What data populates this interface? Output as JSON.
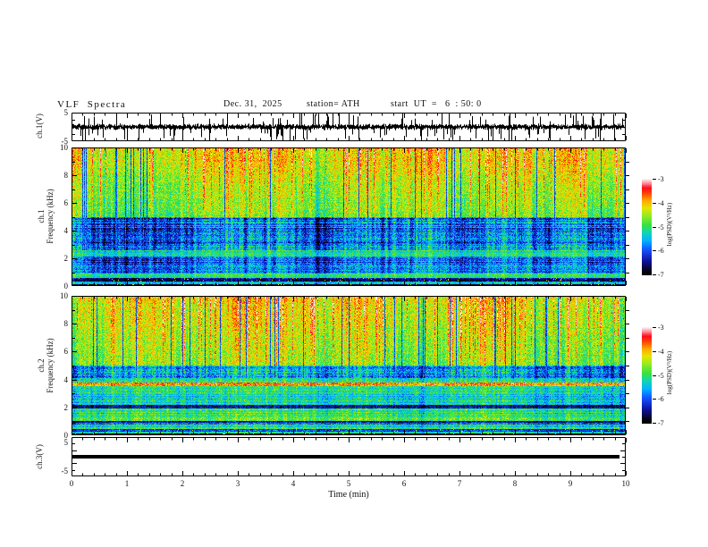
{
  "header": {
    "title": "VLF  Spectra",
    "date": "Dec. 31,  2025",
    "station": "station= ATH",
    "start_ut": "start  UT  =   6  : 50: 0"
  },
  "xaxis": {
    "label": "Time  (min)",
    "ticks": [
      0,
      1,
      2,
      3,
      4,
      5,
      6,
      7,
      8,
      9,
      10
    ],
    "range_min": [
      0,
      10
    ]
  },
  "colorbars": [
    {
      "label": "log(PSD)(V²/Hz)",
      "ticks": [
        -3,
        -4,
        -5,
        -6,
        -7
      ],
      "range": [
        -7,
        -3
      ]
    },
    {
      "label": "log(PSD)(V²/Hz)",
      "ticks": [
        -3,
        -4,
        -5,
        -6,
        -7
      ],
      "range": [
        -7,
        -3
      ]
    }
  ],
  "colormap_stops": [
    [
      0.0,
      0,
      0,
      0
    ],
    [
      0.05,
      5,
      5,
      30
    ],
    [
      0.14,
      15,
      15,
      150
    ],
    [
      0.26,
      20,
      80,
      255
    ],
    [
      0.36,
      0,
      180,
      255
    ],
    [
      0.45,
      20,
      215,
      170
    ],
    [
      0.52,
      55,
      225,
      65
    ],
    [
      0.62,
      150,
      235,
      35
    ],
    [
      0.7,
      232,
      228,
      0
    ],
    [
      0.78,
      255,
      165,
      0
    ],
    [
      0.85,
      255,
      70,
      0
    ],
    [
      0.91,
      255,
      10,
      30
    ],
    [
      0.96,
      255,
      150,
      160
    ],
    [
      1.0,
      255,
      235,
      240
    ]
  ],
  "chart_data": [
    {
      "id": "ch1_wave",
      "type": "line",
      "ylabel": "ch.1(V)",
      "ylim": [
        -5,
        5
      ],
      "yticks": [
        5,
        -5
      ],
      "signal": {
        "kind": "broadband-noise",
        "sigma_V": 0.7,
        "spike_rate": 0.13,
        "spike_amp_V": [
          2,
          5.5
        ]
      }
    },
    {
      "id": "ch1_spec",
      "type": "heatmap",
      "ylabel": [
        "ch.1",
        "Frequency  (kHz)"
      ],
      "ylim": [
        0,
        10
      ],
      "yticks": [
        10,
        8,
        6,
        4,
        2,
        0
      ],
      "value_range": [
        -7,
        -3
      ],
      "time_range_min": [
        0,
        10
      ],
      "bands": [
        {
          "f": [
            5,
            10
          ],
          "base": [
            -4.85,
            -4.2
          ],
          "col": 1.2,
          "nz": 0.85,
          "st": 0.1,
          "red": 1.15,
          "dk": 1
        },
        {
          "f": [
            2.6,
            5
          ],
          "base": [
            -6.05,
            -6.05
          ],
          "col": 1.7,
          "nz": 0.95,
          "st": 0.38,
          "dk": 1
        },
        {
          "f": [
            2.1,
            2.6
          ],
          "base": [
            -5.25,
            -5.25
          ],
          "col": 0.9,
          "nz": 0.7,
          "st": 0.2
        },
        {
          "f": [
            1.5,
            2.1
          ],
          "base": [
            -6.15,
            -6.0
          ],
          "col": 1.5,
          "nz": 0.9,
          "st": 0.25
        },
        {
          "f": [
            0.9,
            1.5
          ],
          "base": [
            -5.85,
            -5.85
          ],
          "col": 1.3,
          "nz": 0.9,
          "st": 0.25
        },
        {
          "f": [
            0.55,
            0.9
          ],
          "base": [
            -5.05,
            -5.05
          ],
          "col": 0.7,
          "nz": 0.7,
          "st": 0.2
        },
        {
          "f": [
            0.3,
            0.55
          ],
          "base": [
            -6.55,
            -6.55
          ],
          "col": 0.9,
          "nz": 0.8,
          "st": 0.3,
          "sp": 0.04
        },
        {
          "f": [
            0.15,
            0.3
          ],
          "base": [
            -5.35,
            -5.35
          ],
          "col": 0.6,
          "nz": 0.7,
          "st": 0.2
        },
        {
          "f": [
            0,
            0.15
          ],
          "base": [
            -6.9,
            -6.9
          ],
          "col": 0.3,
          "nz": 0.4,
          "st": 0.1,
          "sp": 0.08
        }
      ]
    },
    {
      "id": "ch2_spec",
      "type": "heatmap",
      "ylabel": [
        "ch.2",
        "Frequency  (kHz)"
      ],
      "ylim": [
        0,
        10
      ],
      "yticks": [
        10,
        8,
        6,
        4,
        2,
        0
      ],
      "value_range": [
        -7,
        -3
      ],
      "time_range_min": [
        0,
        10
      ],
      "bands": [
        {
          "f": [
            5,
            10
          ],
          "base": [
            -4.8,
            -4.35
          ],
          "col": 1.25,
          "nz": 0.85,
          "st": 0.1,
          "red": 1.2,
          "dk": 1
        },
        {
          "f": [
            4.1,
            5
          ],
          "base": [
            -5.9,
            -5.9
          ],
          "col": 1.5,
          "nz": 0.95,
          "st": 0.3,
          "dk": 1
        },
        {
          "f": [
            3.78,
            4.1
          ],
          "base": [
            -5.35,
            -5.35
          ],
          "col": 1.0,
          "nz": 0.8,
          "st": 0.2
        },
        {
          "f": [
            3.5,
            3.78
          ],
          "base": [
            -4.05,
            -4.05
          ],
          "col": 0.5,
          "nz": 0.7,
          "st": 0.15,
          "red": 0.5
        },
        {
          "f": [
            2.2,
            3.5
          ],
          "base": [
            -5.35,
            -5.35
          ],
          "col": 0.9,
          "nz": 0.8,
          "st": 0.25
        },
        {
          "f": [
            1.95,
            2.2
          ],
          "base": [
            -6.55,
            -6.55
          ],
          "col": 0.6,
          "nz": 0.7,
          "st": 0.2
        },
        {
          "f": [
            1.0,
            1.95
          ],
          "base": [
            -5.15,
            -5.15
          ],
          "col": 0.9,
          "nz": 0.8,
          "st": 0.25
        },
        {
          "f": [
            0.78,
            1.0
          ],
          "base": [
            -6.3,
            -6.3
          ],
          "col": 0.8,
          "nz": 0.8,
          "st": 0.3
        },
        {
          "f": [
            0.45,
            0.78
          ],
          "base": [
            -5.3,
            -5.3
          ],
          "col": 0.8,
          "nz": 0.8,
          "st": 0.3,
          "red": 0.3
        },
        {
          "f": [
            0.28,
            0.45
          ],
          "base": [
            -6.2,
            -6.2
          ],
          "col": 0.7,
          "nz": 0.8,
          "st": 0.3,
          "sp": 0.03
        },
        {
          "f": [
            0.12,
            0.28
          ],
          "base": [
            -5.6,
            -5.6
          ],
          "col": 0.6,
          "nz": 0.8,
          "st": 0.3
        },
        {
          "f": [
            0,
            0.12
          ],
          "base": [
            -6.95,
            -6.95
          ],
          "col": 0.2,
          "nz": 0.3,
          "st": 0.1,
          "sp": 0.05
        }
      ]
    },
    {
      "id": "ch3_wave",
      "type": "line",
      "ylabel": "ch.3(V)",
      "ylim": [
        -7,
        7
      ],
      "yticks": [
        5,
        -5
      ],
      "signal": {
        "kind": "constant",
        "value_V": 0,
        "line_thickness_px": 4
      }
    }
  ]
}
